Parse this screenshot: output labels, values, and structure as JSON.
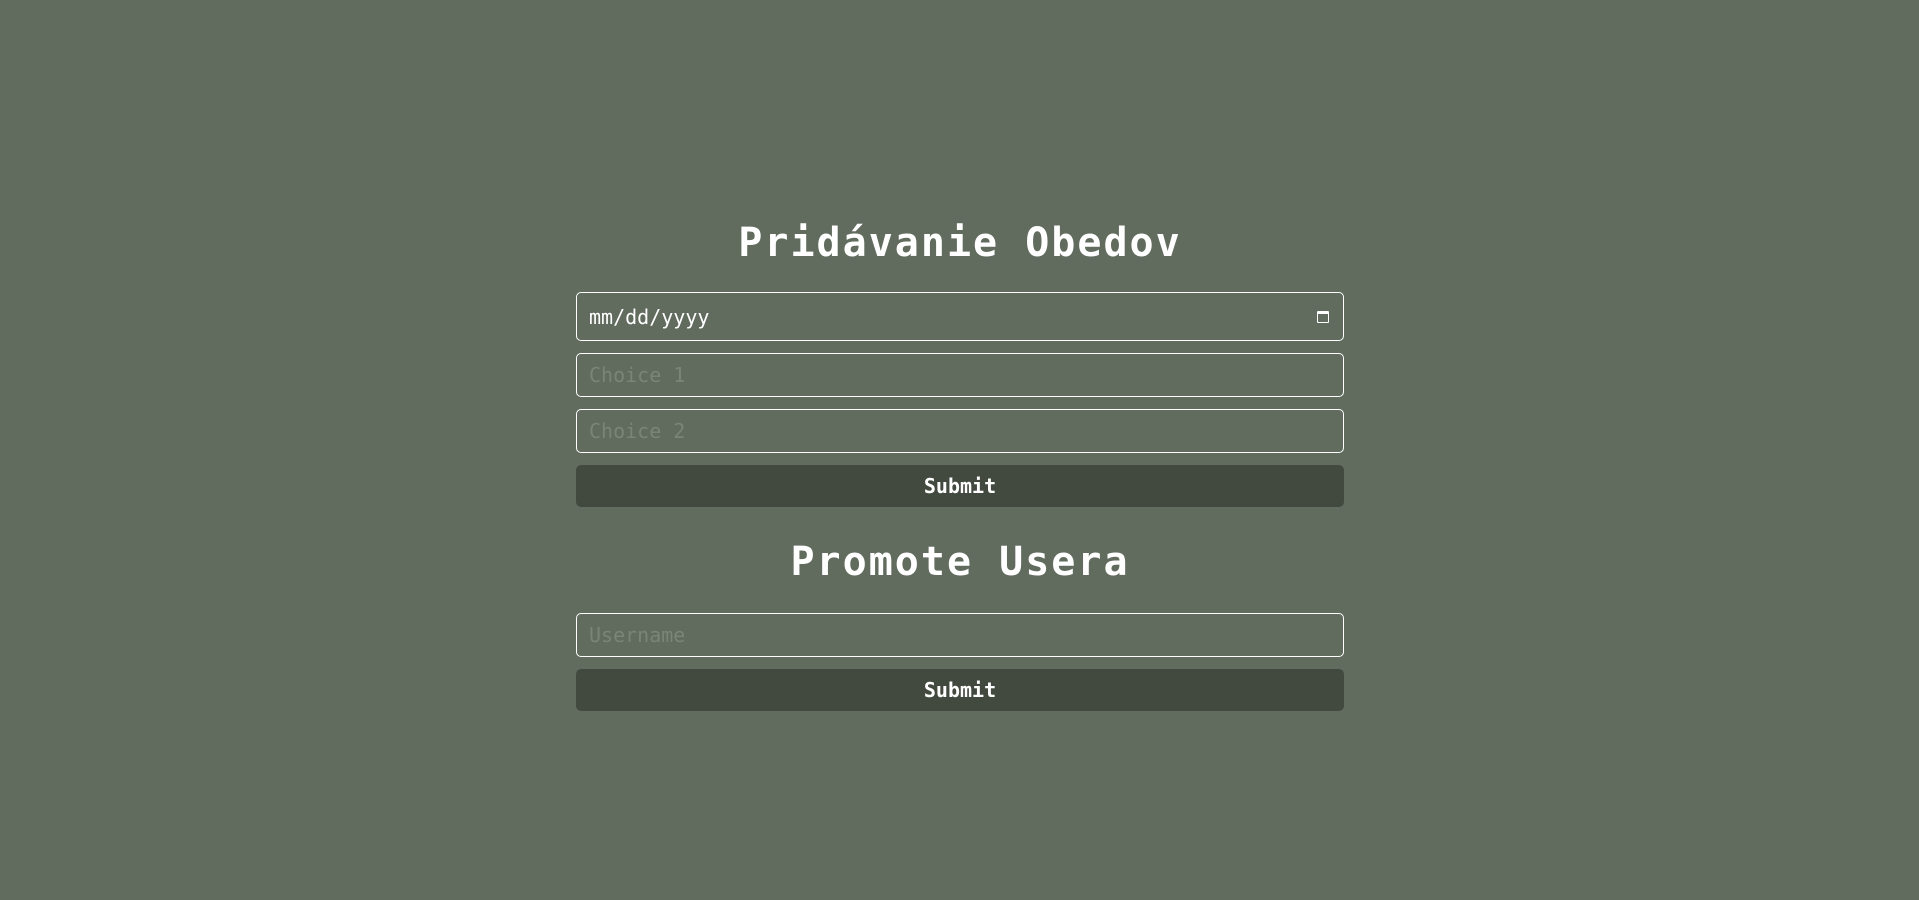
{
  "meals_form": {
    "title": "Pridávanie Obedov",
    "date_placeholder": "mm/dd/yyyy",
    "choice1_placeholder": "Choice 1",
    "choice2_placeholder": "Choice 2",
    "submit_label": "Submit"
  },
  "promote_form": {
    "title": "Promote Usera",
    "username_placeholder": "Username",
    "submit_label": "Submit"
  },
  "colors": {
    "background": "#616b5e",
    "button": "#424a3f",
    "text": "#ffffff",
    "placeholder": "#7a8477"
  },
  "icons": {
    "date_picker": "calendar-icon"
  }
}
